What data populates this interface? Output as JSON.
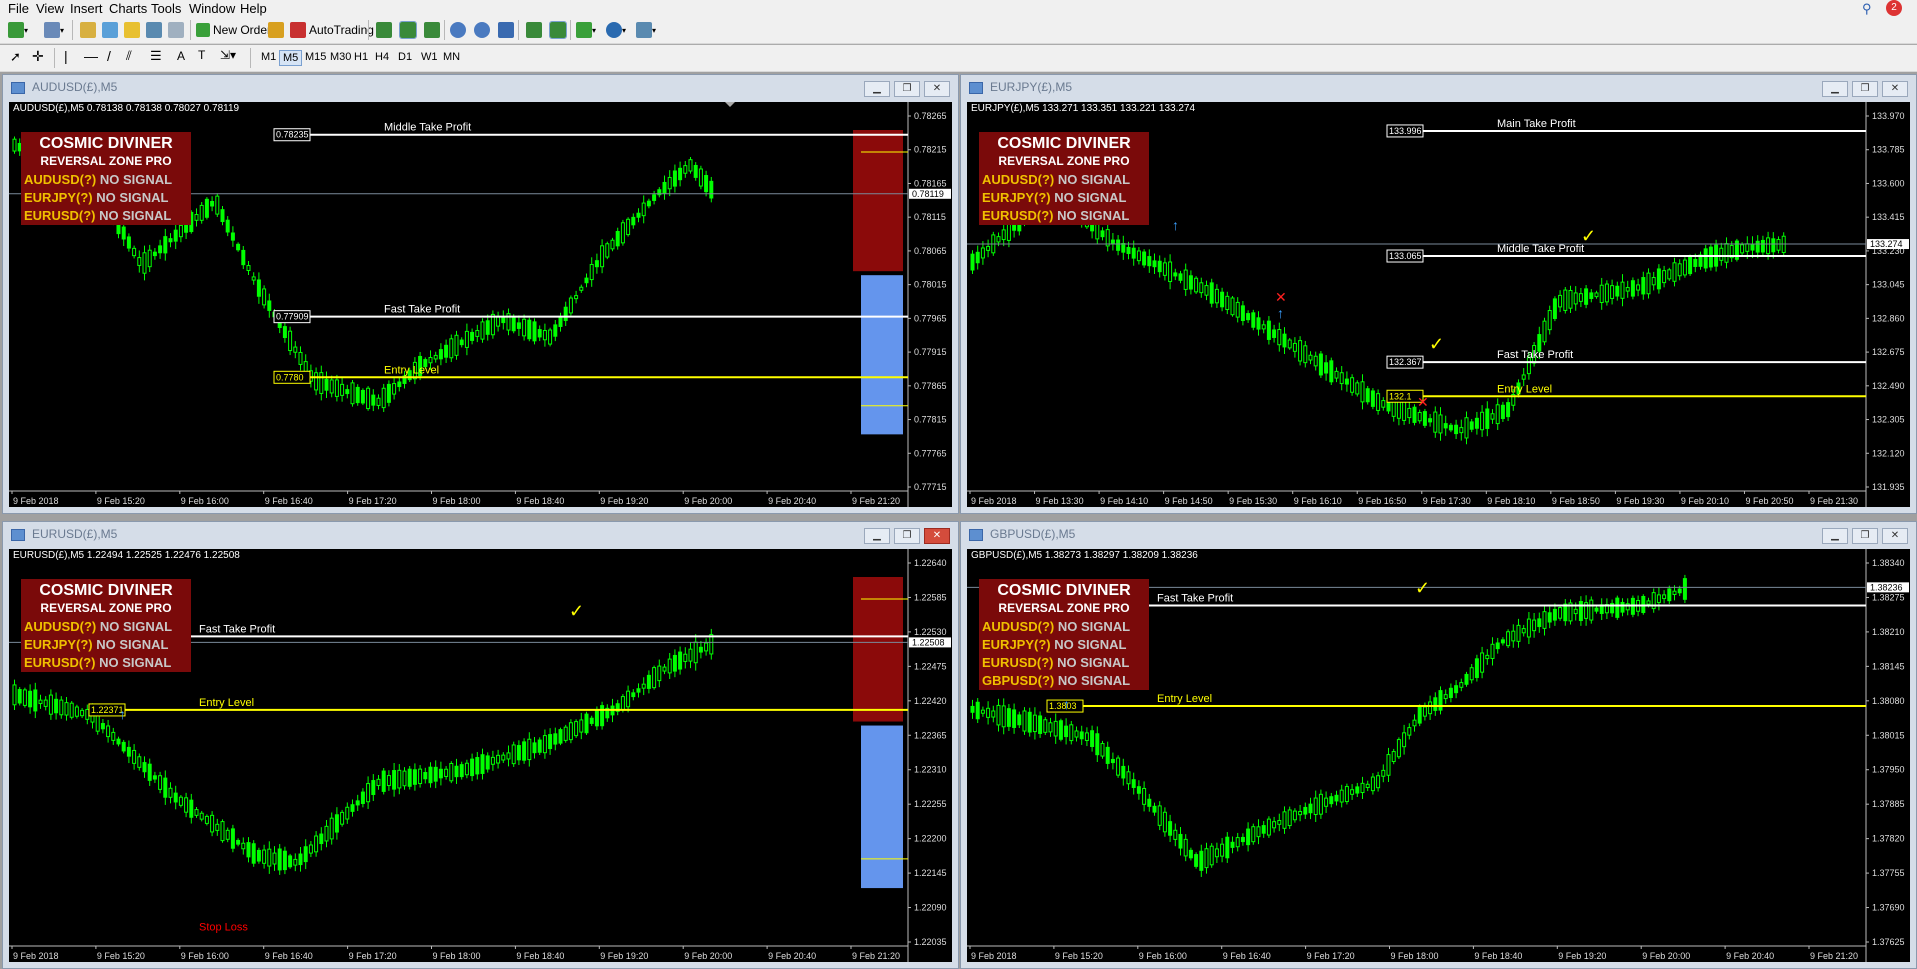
{
  "menu": [
    "File",
    "View",
    "Insert",
    "Charts",
    "Tools",
    "Window",
    "Help"
  ],
  "toolbar": {
    "new_order": "New Order",
    "auto_trading": "AutoTrading",
    "timeframes": [
      "M1",
      "M5",
      "M15",
      "M30",
      "H1",
      "H4",
      "D1",
      "W1",
      "MN"
    ],
    "active_timeframe": "M5",
    "notification_count": "2"
  },
  "panel": {
    "title": "COSMIC DIVINER",
    "subtitle": "REVERSAL ZONE PRO",
    "status": "NO SIGNAL"
  },
  "charts": [
    {
      "title": "AUDUSD(£),M5",
      "info": "AUDUSD(£),M5  0.78138 0.78138 0.78027 0.78119",
      "close_active": false,
      "panel_symbols": [
        "AUDUSD(?)",
        "EURJPY(?)",
        "EURUSD(?)"
      ],
      "prices": [
        "0.78265",
        "0.78215",
        "0.78165",
        "0.78115",
        "0.78065",
        "0.78015",
        "0.77965",
        "0.77915",
        "0.77865",
        "0.77815",
        "0.77765",
        "0.77715"
      ],
      "price_range": [
        0.77715,
        0.78275
      ],
      "current": "0.78119",
      "times": [
        "9 Feb 2018",
        "9 Feb 15:20",
        "9 Feb 16:00",
        "9 Feb 16:40",
        "9 Feb 17:20",
        "9 Feb 18:00",
        "9 Feb 18:40",
        "9 Feb 19:20",
        "9 Feb 20:00",
        "9 Feb 20:40",
        "9 Feb 21:20"
      ],
      "levels": [
        {
          "label": "Middle Take Profit",
          "price": "0.78235",
          "color": "#ffffff"
        },
        {
          "label": "Fast Take Profit",
          "price": "0.77909",
          "color": "#ffffff"
        },
        {
          "label": "Entry Level",
          "price": "0.7780",
          "color": "#ffff00"
        }
      ],
      "profile": true
    },
    {
      "title": "EURJPY(£),M5",
      "info": "EURJPY(£),M5  133.271 133.351 133.221 133.274",
      "close_active": false,
      "panel_symbols": [
        "AUDUSD(?)",
        "EURJPY(?)",
        "EURUSD(?)"
      ],
      "prices": [
        "133.970",
        "133.785",
        "133.600",
        "133.415",
        "133.230",
        "133.045",
        "132.860",
        "132.675",
        "132.490",
        "132.305",
        "132.120",
        "131.935"
      ],
      "price_range": [
        131.935,
        134.02
      ],
      "current": "133.274",
      "times": [
        "9 Feb 2018",
        "9 Feb 13:30",
        "9 Feb 14:10",
        "9 Feb 14:50",
        "9 Feb 15:30",
        "9 Feb 16:10",
        "9 Feb 16:50",
        "9 Feb 17:30",
        "9 Feb 18:10",
        "9 Feb 18:50",
        "9 Feb 19:30",
        "9 Feb 20:10",
        "9 Feb 20:50",
        "9 Feb 21:30"
      ],
      "levels": [
        {
          "label": "Main Take Profit",
          "price": "133.996",
          "color": "#ffffff"
        },
        {
          "label": "Middle Take Profit",
          "price": "133.065",
          "color": "#ffffff"
        },
        {
          "label": "Fast Take Profit",
          "price": "132.367",
          "color": "#ffffff"
        },
        {
          "label": "Entry Level",
          "price": "132.1",
          "color": "#ffff00"
        }
      ],
      "profile": false
    },
    {
      "title": "EURUSD(£),M5",
      "info": "EURUSD(£),M5  1.22494 1.22525 1.22476 1.22508",
      "close_active": true,
      "panel_symbols": [
        "AUDUSD(?)",
        "EURJPY(?)",
        "EURUSD(?)"
      ],
      "prices": [
        "1.22640",
        "1.22585",
        "1.22530",
        "1.22475",
        "1.22420",
        "1.22365",
        "1.22310",
        "1.22255",
        "1.22200",
        "1.22145",
        "1.22090",
        "1.22035"
      ],
      "price_range": [
        1.22035,
        1.2267
      ],
      "current": "1.22508",
      "times": [
        "9 Feb 2018",
        "9 Feb 15:20",
        "9 Feb 16:00",
        "9 Feb 16:40",
        "9 Feb 17:20",
        "9 Feb 18:00",
        "9 Feb 18:40",
        "9 Feb 19:20",
        "9 Feb 20:00",
        "9 Feb 20:40",
        "9 Feb 21:20"
      ],
      "levels": [
        {
          "label": "Fast Take Profit",
          "price": "",
          "color": "#ffffff"
        },
        {
          "label": "Entry Level",
          "price": "1.22371",
          "color": "#ffff00"
        },
        {
          "label": "Stop Loss",
          "price": "",
          "color": "#ff0000"
        }
      ],
      "profile": true
    },
    {
      "title": "GBPUSD(£),M5",
      "info": "GBPUSD(£),M5  1.38273 1.38297 1.38209 1.38236",
      "close_active": false,
      "panel_symbols": [
        "AUDUSD(?)",
        "EURJPY(?)",
        "EURUSD(?)",
        "GBPUSD(?)"
      ],
      "prices": [
        "1.38340",
        "1.38275",
        "1.38210",
        "1.38145",
        "1.38080",
        "1.38015",
        "1.37950",
        "1.37885",
        "1.37820",
        "1.37755",
        "1.37690",
        "1.37625"
      ],
      "price_range": [
        1.37625,
        1.38365
      ],
      "current": "1.38236",
      "times": [
        "9 Feb 2018",
        "9 Feb 15:20",
        "9 Feb 16:00",
        "9 Feb 16:40",
        "9 Feb 17:20",
        "9 Feb 18:00",
        "9 Feb 18:40",
        "9 Feb 19:20",
        "9 Feb 20:00",
        "9 Feb 20:40",
        "9 Feb 21:20"
      ],
      "levels": [
        {
          "label": "Fast Take Profit",
          "price": "",
          "color": "#ffffff"
        },
        {
          "label": "Entry Level",
          "price": "1.3803",
          "color": "#ffff00"
        }
      ],
      "profile": false
    }
  ],
  "colors": {
    "candle": "#00ff00",
    "background": "#000000",
    "panel": "#7a0a0a",
    "profile_top": "#8b0a0a",
    "profile_bottom": "#6495ed"
  }
}
